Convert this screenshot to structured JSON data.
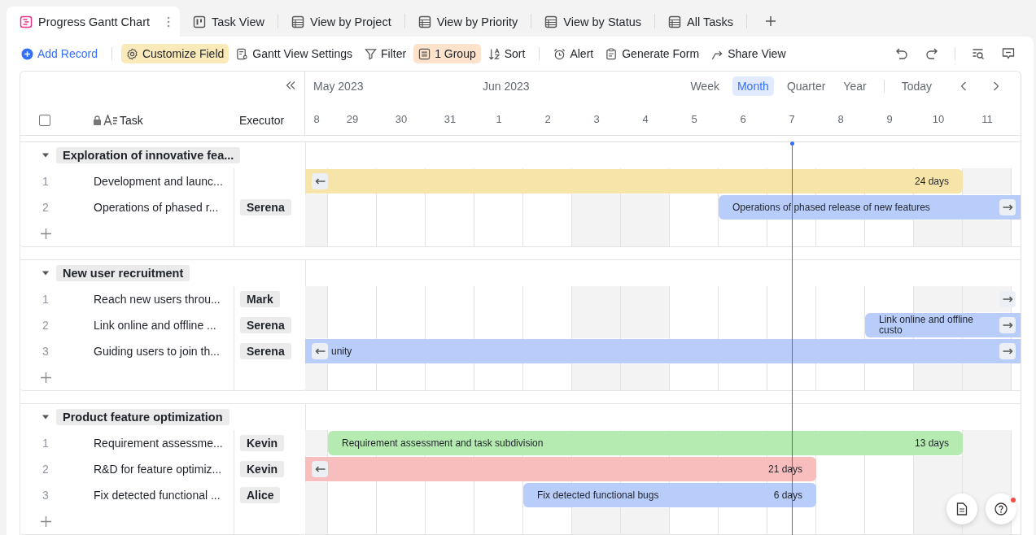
{
  "tabs": [
    {
      "label": "Progress Gantt Chart",
      "kind": "gantt",
      "selected": true
    },
    {
      "label": "Task View",
      "kind": "board",
      "selected": false
    },
    {
      "label": "View by Project",
      "kind": "table",
      "selected": false
    },
    {
      "label": "View by Priority",
      "kind": "table",
      "selected": false
    },
    {
      "label": "View by Status",
      "kind": "table",
      "selected": false
    },
    {
      "label": "All Tasks",
      "kind": "table",
      "selected": false
    }
  ],
  "toolbar": [
    [
      {
        "label": "Add Record",
        "kind": "add"
      }
    ],
    [
      {
        "label": "Customize Field",
        "kind": "customize",
        "color": "#faeab9"
      },
      {
        "label": "Gantt View Settings",
        "kind": "settings"
      },
      {
        "label": "Filter",
        "kind": "filter"
      },
      {
        "label": "1 Group",
        "kind": "group",
        "color": "#fde2cc"
      },
      {
        "label": "Sort",
        "kind": "sort"
      }
    ],
    [
      {
        "label": "Alert",
        "kind": "alert"
      },
      {
        "label": "Generate Form",
        "kind": "form"
      },
      {
        "label": "Share View",
        "kind": "share"
      }
    ]
  ],
  "table": {
    "select_all_checked": false,
    "task": "Task",
    "executor": "Executor"
  },
  "timeline": {
    "today_button": "Today",
    "months": [
      "May 2023",
      "Jun 2023"
    ],
    "scales": [
      {
        "label": "Week",
        "selected": false
      },
      {
        "label": "Month",
        "selected": true
      },
      {
        "label": "Quarter",
        "selected": false
      },
      {
        "label": "Year",
        "selected": false
      }
    ],
    "days": [
      "8",
      "29",
      "30",
      "31",
      "1",
      "2",
      "3",
      "4",
      "5",
      "6",
      "7",
      "8",
      "9",
      "10",
      "11"
    ]
  },
  "groups": [
    {
      "title": "Exploration of innovative fea...",
      "expanded": true,
      "rows": [
        {
          "number": "1",
          "task": "Development and launc...",
          "duration": "24 days",
          "color": "#f7e4a9"
        },
        {
          "number": "2",
          "task": "Operations of phased r...",
          "executor": "Serena",
          "label": "Operations of phased release of new features",
          "color": "#b9cdfb"
        }
      ]
    },
    {
      "title": "New user recruitment",
      "expanded": true,
      "rows": [
        {
          "number": "1",
          "task": "Reach new users throu...",
          "executor": "Mark"
        },
        {
          "number": "2",
          "task": "Link online and offline ...",
          "executor": "Serena",
          "label": "Link online and offline custo",
          "color": "#b9cdfb"
        },
        {
          "number": "3",
          "task": "Guiding users to join th...",
          "executor": "Serena",
          "label": "unity",
          "color": "#b9cdfb"
        }
      ]
    },
    {
      "title": "Product feature optimization",
      "expanded": true,
      "rows": [
        {
          "number": "1",
          "task": "Requirement assessme...",
          "executor": "Kevin",
          "label": "Requirement assessment and task subdivision",
          "duration": "13 days",
          "color": "#b5ebb0"
        },
        {
          "number": "2",
          "task": "R&D for feature optimiz...",
          "executor": "Kevin",
          "duration": "21 days",
          "color": "#f8bebe"
        },
        {
          "number": "3",
          "task": "Fix detected functional ...",
          "executor": "Alice",
          "label": "Fix detected functional bugs",
          "duration": "6 days",
          "color": "#b9cdfb"
        }
      ]
    }
  ]
}
